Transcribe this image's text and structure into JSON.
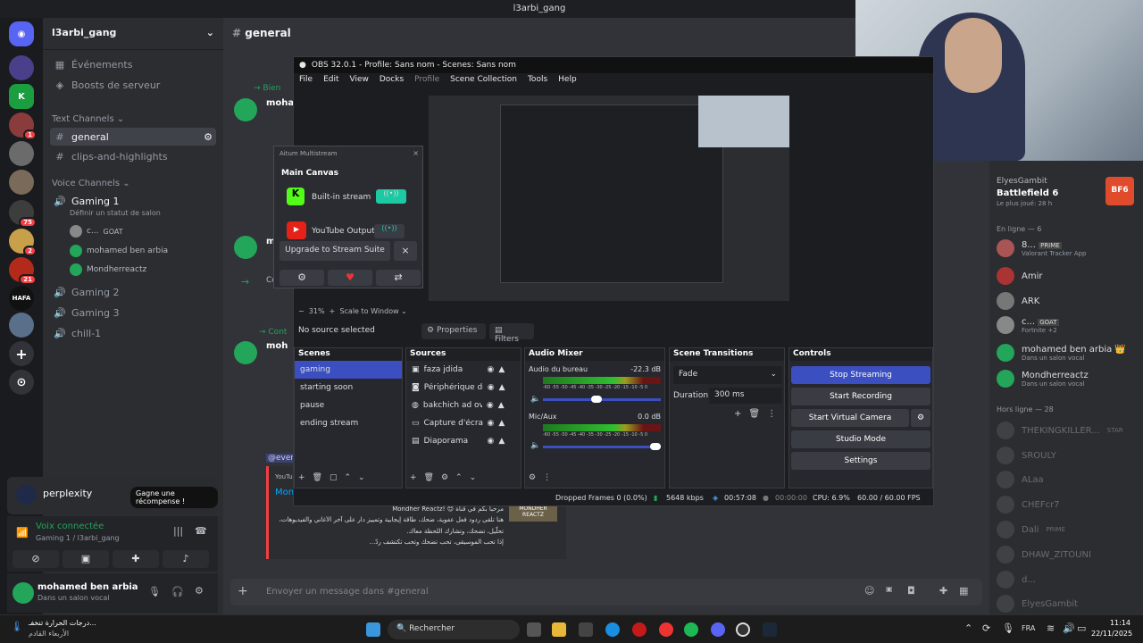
{
  "window": {
    "title": "l3arbi_gang"
  },
  "server": {
    "name": "l3arbi_gang",
    "events": "Événements",
    "boosts": "Boosts de serveur"
  },
  "text_channels": {
    "label": "Text Channels",
    "items": [
      "general",
      "clips-and-highlights"
    ]
  },
  "voice_channels": {
    "label": "Voice Channels",
    "gaming1": "Gaming 1",
    "status": "Définir un statut de salon",
    "users": [
      "c...",
      "mohamed ben arbia",
      "Mondherreactz"
    ],
    "goat": "GOAT",
    "others": [
      "Gaming 2",
      "Gaming 3",
      "chill-1"
    ]
  },
  "badges": [
    "1",
    "75",
    "2",
    "21"
  ],
  "hafa": "HAFA",
  "chat": {
    "channel": "general",
    "msg1_prefix": "→ Bien",
    "msg1_user": "mohan",
    "msg2": "m",
    "msg3": "Co",
    "msg4_prefix": "→ Cont",
    "msg4_user": "moh",
    "everyone": "@ever",
    "youtube": "YouTu",
    "mon": "Mon",
    "arabic1": "مرحبا بكم في قناة 😊 !Mondher Reactz",
    "arabic2": "هنا تلقى ردود فعل عفوية، ضحك، طاقة إيجابية وتمييز دار على آخر الأغاني والفيديوهات،",
    "arabic3": "تحلّيل، تضحك، وتشارك اللحظة معاك.",
    "arabic4": "إذا تحب الموسيقى، تحب تضحك وتحب تكتشف ردّ...",
    "thumb": "MONDHER REACTZ",
    "placeholder": "Envoyer un message dans #general"
  },
  "obs": {
    "title": "OBS 32.0.1 - Profile: Sans nom - Scenes: Sans nom",
    "menu": [
      "File",
      "Edit",
      "View",
      "Docks",
      "Profile",
      "Scene Collection",
      "Tools",
      "Help"
    ],
    "zoom": "31%",
    "scale": "Scale to Window",
    "no_source": "No source selected",
    "properties": "Properties",
    "filters": "Filters",
    "scenes_title": "Scenes",
    "scenes": [
      "gaming",
      "starting soon",
      "pause",
      "ending stream"
    ],
    "sources_title": "Sources",
    "sources": [
      "faza jdida",
      "Périphérique de c",
      "bakchich ad over",
      "Capture d'écran",
      "Diaporama"
    ],
    "mixer_title": "Audio Mixer",
    "ch1": "Audio du bureau",
    "ch1_db": "-22.3 dB",
    "ch2": "Mic/Aux",
    "ch2_db": "0.0 dB",
    "scale_ticks": "-60 -55 -50 -45 -40 -35 -30 -25 -20 -15 -10 -5 0",
    "transitions_title": "Scene Transitions",
    "transition": "Fade",
    "duration_label": "Duration",
    "duration": "300 ms",
    "controls_title": "Controls",
    "controls": [
      "Stop Streaming",
      "Start Recording",
      "Start Virtual Camera",
      "Studio Mode",
      "Settings"
    ],
    "status": {
      "dropped": "Dropped Frames 0 (0.0%)",
      "kbps": "5648 kbps",
      "stream_time": "00:57:08",
      "rec_time": "00:00:00",
      "cpu": "CPU: 6.9%",
      "fps": "60.00 / 60.00 FPS"
    }
  },
  "multistream": {
    "title": "Aitum Multistream",
    "canvas": "Main Canvas",
    "builtin": "Built-in stream",
    "youtube": "YouTube Output",
    "upgrade": "Upgrade to Stream Suite"
  },
  "perplexity": {
    "name": "perplexity",
    "cta": "Gagne une récompense !"
  },
  "voice": {
    "connected": "Voix connectée",
    "where": "Gaming 1 / l3arbi_gang"
  },
  "user": {
    "name": "mohamed ben arbia",
    "status": "Dans un salon vocal"
  },
  "members": {
    "activity_user": "ElyesGambit",
    "activity_game": "Battlefield 6",
    "activity_sub": "Le plus joué: 28 h",
    "bf": "BF6",
    "online_label": "En ligne — 6",
    "online": [
      {
        "name": "8...",
        "tag": "PRIME",
        "sub": "Valorant Tracker App"
      },
      {
        "name": "Amir",
        "tag": "",
        "sub": ""
      },
      {
        "name": "ARK",
        "tag": "",
        "sub": ""
      },
      {
        "name": "c...",
        "tag": "GOAT",
        "sub": "Fortnite +2"
      },
      {
        "name": "mohamed ben arbia 👑",
        "tag": "",
        "sub": "Dans un salon vocal"
      },
      {
        "name": "Mondherreactz",
        "tag": "",
        "sub": "Dans un salon vocal"
      }
    ],
    "offline_label": "Hors ligne — 28",
    "offline": [
      "THEKINGKILLER...",
      "SROULY",
      "ALaa",
      "CHEFcr7",
      "Dali",
      "DHAW_ZITOUNI",
      "d...",
      "ElyesGambit"
    ],
    "offline_tags": [
      "STAR",
      "",
      "",
      "",
      "PRIME",
      "",
      "",
      ""
    ]
  },
  "taskbar": {
    "weather1": "درجات الحرارة تنخفـ...",
    "weather2": "الأربعاء القادم",
    "search": "Rechercher",
    "lang": "FRA",
    "time": "11:14",
    "date": "22/11/2025"
  }
}
